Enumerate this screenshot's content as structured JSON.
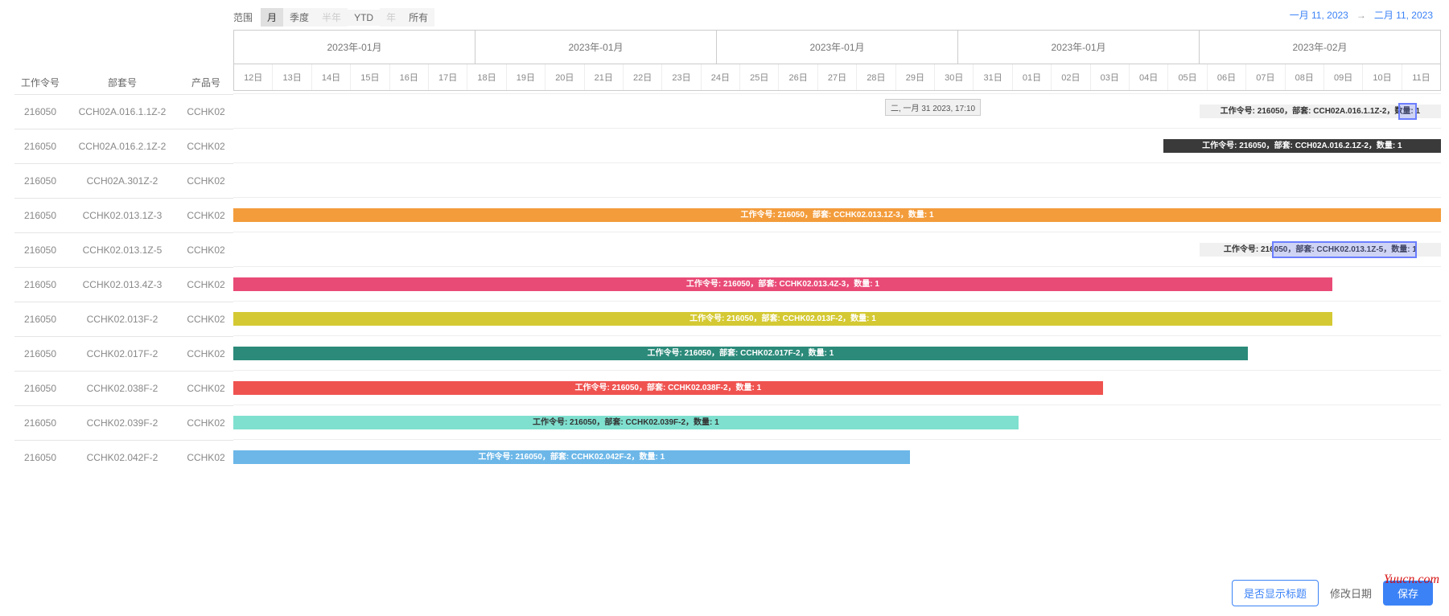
{
  "toolbar": {
    "label": "范围",
    "ranges": [
      {
        "label": "月",
        "active": true,
        "disabled": false
      },
      {
        "label": "季度",
        "active": false,
        "disabled": false
      },
      {
        "label": "半年",
        "active": false,
        "disabled": true
      },
      {
        "label": "YTD",
        "active": false,
        "disabled": false
      },
      {
        "label": "年",
        "active": false,
        "disabled": true
      },
      {
        "label": "所有",
        "active": false,
        "disabled": false
      }
    ]
  },
  "date_range": {
    "from": "一月 11, 2023",
    "arrow": "→",
    "to": "二月 11, 2023"
  },
  "left_headers": {
    "work": "工作令号",
    "part": "部套号",
    "product": "产品号"
  },
  "months": [
    "2023年-01月",
    "2023年-01月",
    "2023年-01月",
    "2023年-01月",
    "2023年-02月"
  ],
  "days": [
    "12日",
    "13日",
    "14日",
    "15日",
    "16日",
    "17日",
    "18日",
    "19日",
    "20日",
    "21日",
    "22日",
    "23日",
    "24日",
    "25日",
    "26日",
    "27日",
    "28日",
    "29日",
    "30日",
    "31日",
    "01日",
    "02日",
    "03日",
    "04日",
    "05日",
    "06日",
    "07日",
    "08日",
    "09日",
    "10日",
    "11日"
  ],
  "tooltip": "二, 一月 31 2023, 17:10",
  "rows": [
    {
      "work": "216050",
      "part": "CCH02A.016.1.1Z-2",
      "product": "CCHK02",
      "bar": {
        "left_pct": 80,
        "width_pct": 20,
        "color": "#f0f0f0",
        "text": "工作令号: 216050，部套: CCH02A.016.1.1Z-2，数量: 1",
        "dark": true,
        "highlight": true
      }
    },
    {
      "work": "216050",
      "part": "CCH02A.016.2.1Z-2",
      "product": "CCHK02",
      "bar": {
        "left_pct": 77,
        "width_pct": 23,
        "color": "#3a3a3a",
        "text": "工作令号: 216050，部套: CCH02A.016.2.1Z-2，数量: 1"
      }
    },
    {
      "work": "216050",
      "part": "CCH02A.301Z-2",
      "product": "CCHK02"
    },
    {
      "work": "216050",
      "part": "CCHK02.013.1Z-3",
      "product": "CCHK02",
      "bar": {
        "left_pct": 0,
        "width_pct": 100,
        "color": "#f39c3b",
        "text": "工作令号: 216050，部套: CCHK02.013.1Z-3，数量: 1"
      }
    },
    {
      "work": "216050",
      "part": "CCHK02.013.1Z-5",
      "product": "CCHK02",
      "bar": {
        "left_pct": 80,
        "width_pct": 20,
        "color": "#f0f0f0",
        "text": "工作令号: 216050，部套: CCHK02.013.1Z-5，数量: 1",
        "dark": true,
        "highlight_band": true
      }
    },
    {
      "work": "216050",
      "part": "CCHK02.013.4Z-3",
      "product": "CCHK02",
      "bar": {
        "left_pct": 0,
        "width_pct": 91,
        "color": "#e94b77",
        "text": "工作令号: 216050，部套: CCHK02.013.4Z-3，数量: 1"
      }
    },
    {
      "work": "216050",
      "part": "CCHK02.013F-2",
      "product": "CCHK02",
      "bar": {
        "left_pct": 0,
        "width_pct": 91,
        "color": "#d4c933",
        "text": "工作令号: 216050，部套: CCHK02.013F-2，数量: 1"
      }
    },
    {
      "work": "216050",
      "part": "CCHK02.017F-2",
      "product": "CCHK02",
      "bar": {
        "left_pct": 0,
        "width_pct": 84,
        "color": "#2b8a7a",
        "text": "工作令号: 216050，部套: CCHK02.017F-2，数量: 1"
      }
    },
    {
      "work": "216050",
      "part": "CCHK02.038F-2",
      "product": "CCHK02",
      "bar": {
        "left_pct": 0,
        "width_pct": 72,
        "color": "#ef5350",
        "text": "工作令号: 216050，部套: CCHK02.038F-2，数量: 1"
      }
    },
    {
      "work": "216050",
      "part": "CCHK02.039F-2",
      "product": "CCHK02",
      "bar": {
        "left_pct": 0,
        "width_pct": 65,
        "color": "#7fe0cf",
        "text": "工作令号: 216050，部套: CCHK02.039F-2，数量: 1",
        "dark": true
      }
    },
    {
      "work": "216050",
      "part": "CCHK02.042F-2",
      "product": "CCHK02",
      "bar": {
        "left_pct": 0,
        "width_pct": 56,
        "color": "#6cb7e8",
        "text": "工作令号: 216050，部套: CCHK02.042F-2，数量: 1"
      }
    }
  ],
  "footer": {
    "show_title": "是否显示标题",
    "modify_date": "修改日期",
    "save": "保存"
  },
  "watermark": "Yuucn.com"
}
